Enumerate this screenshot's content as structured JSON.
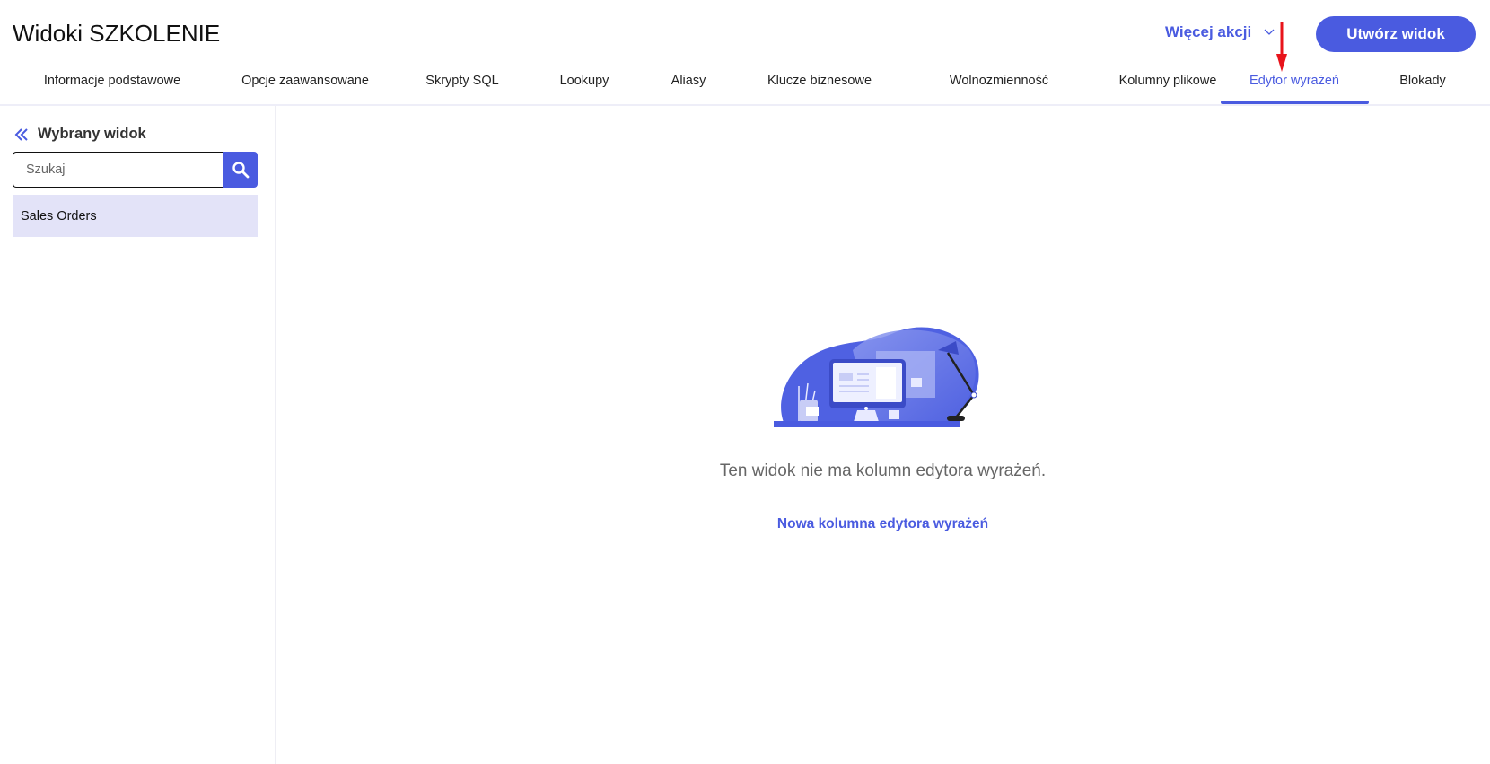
{
  "header": {
    "title": "Widoki SZKOLENIE",
    "more_actions": "Więcej akcji",
    "create_button": "Utwórz widok"
  },
  "tabs": [
    {
      "label": "Informacje podstawowe"
    },
    {
      "label": "Opcje zaawansowane"
    },
    {
      "label": "Skrypty SQL"
    },
    {
      "label": "Lookupy"
    },
    {
      "label": "Aliasy"
    },
    {
      "label": "Klucze biznesowe"
    },
    {
      "label": "Wolnozmienność"
    },
    {
      "label": "Kolumny plikowe"
    },
    {
      "label": "Edytor wyrażeń",
      "active": true
    },
    {
      "label": "Blokady"
    }
  ],
  "sidebar": {
    "heading": "Wybrany widok",
    "search_placeholder": "Szukaj",
    "items": [
      {
        "label": "Sales Orders"
      }
    ]
  },
  "main": {
    "empty_message": "Ten widok nie ma kolumn edytora wyrażeń.",
    "new_column_link": "Nowa kolumna edytora wyrażeń"
  },
  "colors": {
    "accent": "#4a5be0",
    "selected_item": "#e3e3f8",
    "annotation_arrow": "#e8141b"
  }
}
